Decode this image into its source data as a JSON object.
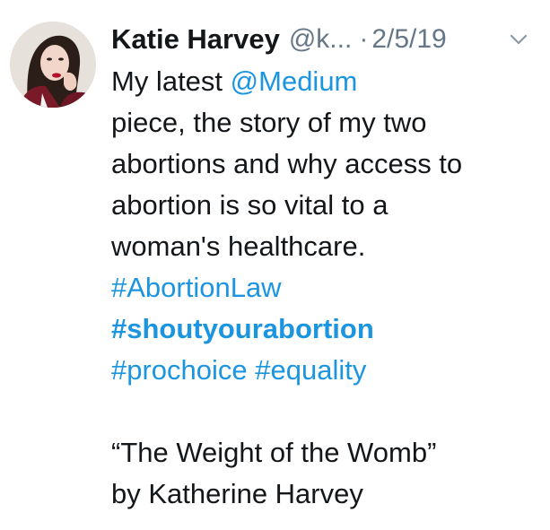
{
  "tweet": {
    "author_name": "Katie Harvey",
    "handle": "@k...",
    "separator": "·",
    "date": "2/5/19",
    "icons": {
      "avatar": "profile-photo",
      "menu": "chevron-down-icon"
    },
    "colors": {
      "text": "#14171a",
      "muted": "#657786",
      "link": "#1b95e0"
    },
    "body": {
      "line1_prefix": "My latest ",
      "mention": "@Medium",
      "line2": "piece, the story of my two",
      "line3": "abortions and why access to",
      "line4": "abortion is so vital to a",
      "line5": "woman's healthcare.",
      "hashtag1": "#AbortionLaw",
      "hashtag2": "#shoutyourabortion",
      "hashtag3": "#prochoice",
      "hashtag4": "#equality",
      "quote_title": "“The Weight of the Womb”",
      "quote_byline": "by Katherine Harvey"
    }
  }
}
